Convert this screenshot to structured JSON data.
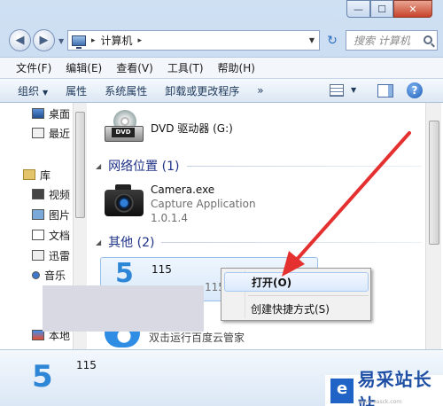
{
  "window": {
    "minimize_glyph": "—",
    "maximize_glyph": "☐",
    "close_glyph": "✕"
  },
  "nav": {
    "back_glyph": "◀",
    "forward_glyph": "▶",
    "breadcrumb_sep": "▸",
    "breadcrumb_item": "计算机",
    "search_placeholder": "搜索 计算机"
  },
  "menu": [
    "文件(F)",
    "编辑(E)",
    "查看(V)",
    "工具(T)",
    "帮助(H)"
  ],
  "toolbar": {
    "organize": "组织",
    "properties": "属性",
    "system_properties": "系统属性",
    "uninstall": "卸载或更改程序",
    "more": "»"
  },
  "navpane": {
    "desktop": "桌面",
    "recent": "最近",
    "libraries": "库",
    "videos": "视频",
    "pictures": "图片",
    "documents": "文档",
    "xunlei": "迅雷",
    "music": "音乐",
    "local": "本地"
  },
  "content": {
    "dvd_label": "DVD",
    "dvd_name": "DVD 驱动器 (G:)",
    "group_network": "网络位置 (1)",
    "camera_name": "Camera.exe",
    "camera_desc": "Capture Application",
    "camera_version": "1.0.1.4",
    "group_other": "其他 (2)",
    "item_115": "115",
    "item_115_sub": "115",
    "item_5": "5",
    "item_baidu": "双击运行百度云管家"
  },
  "context_menu": {
    "open": "打开(O)",
    "create_shortcut": "创建快捷方式(S)"
  },
  "details": {
    "icon_digit": "5",
    "name": "115"
  },
  "watermark": {
    "text": "易采站长站",
    "sub": "www.easck.com"
  },
  "colors": {
    "accent_blue": "#2e86d6",
    "group_header": "#1e3287",
    "arrow_red": "#e53030"
  }
}
